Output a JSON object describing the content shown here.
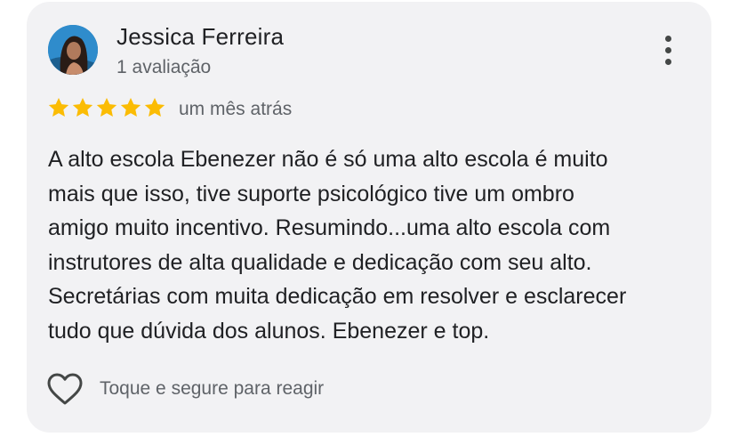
{
  "review": {
    "author_name": "Jessica Ferreira",
    "review_count": "1 avaliação",
    "rating": 5,
    "rating_max": 5,
    "star_color": "#fbbc04",
    "date": "um mês atrás",
    "text_lines": [
      "A alto escola Ebenezer não é só uma alto escola é muito",
      "mais que isso, tive suporte psicológico tive um ombro",
      "amigo muito incentivo. Resumindo...uma alto escola com",
      "instrutores de alta qualidade e dedicação com seu alto.",
      "Secretárias com muita dedicação em resolver e esclarecer",
      "tudo que dúvida dos alunos. Ebenezer e top."
    ],
    "react_label": "Toque e segure para reagir"
  },
  "icons": {
    "more": "more-vert-icon",
    "star": "star-icon",
    "heart": "heart-outline-icon",
    "avatar": "user-avatar"
  }
}
